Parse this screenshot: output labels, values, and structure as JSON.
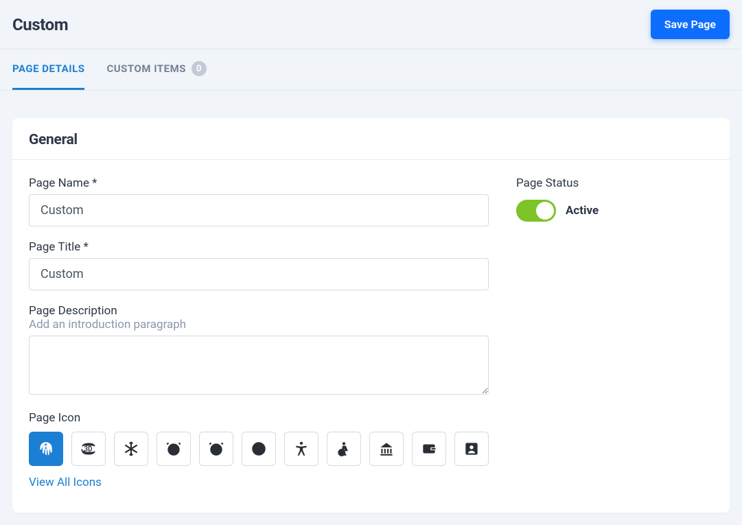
{
  "header": {
    "title": "Custom",
    "save_label": "Save Page"
  },
  "tabs": {
    "page_details": "PAGE DETAILS",
    "custom_items": "CUSTOM ITEMS",
    "custom_items_count": "0"
  },
  "general": {
    "section_title": "General",
    "page_name_label": "Page Name *",
    "page_name_value": "Custom",
    "page_title_label": "Page Title *",
    "page_title_value": "Custom",
    "page_desc_label": "Page Description",
    "page_desc_hint": "Add an introduction paragraph",
    "page_desc_value": "",
    "page_icon_label": "Page Icon",
    "view_all_label": "View All Icons",
    "page_status_label": "Page Status",
    "status_text": "Active",
    "status_on": true
  },
  "icons": [
    {
      "name": "fingerprint-icon",
      "selected": true
    },
    {
      "name": "rotation-3d-icon",
      "selected": false
    },
    {
      "name": "snowflake-icon",
      "selected": false
    },
    {
      "name": "alarm-icon",
      "selected": false
    },
    {
      "name": "alarm-add-icon",
      "selected": false
    },
    {
      "name": "clock-icon",
      "selected": false
    },
    {
      "name": "accessibility-icon",
      "selected": false
    },
    {
      "name": "accessible-icon",
      "selected": false
    },
    {
      "name": "bank-icon",
      "selected": false
    },
    {
      "name": "wallet-icon",
      "selected": false
    },
    {
      "name": "account-box-icon",
      "selected": false
    }
  ]
}
